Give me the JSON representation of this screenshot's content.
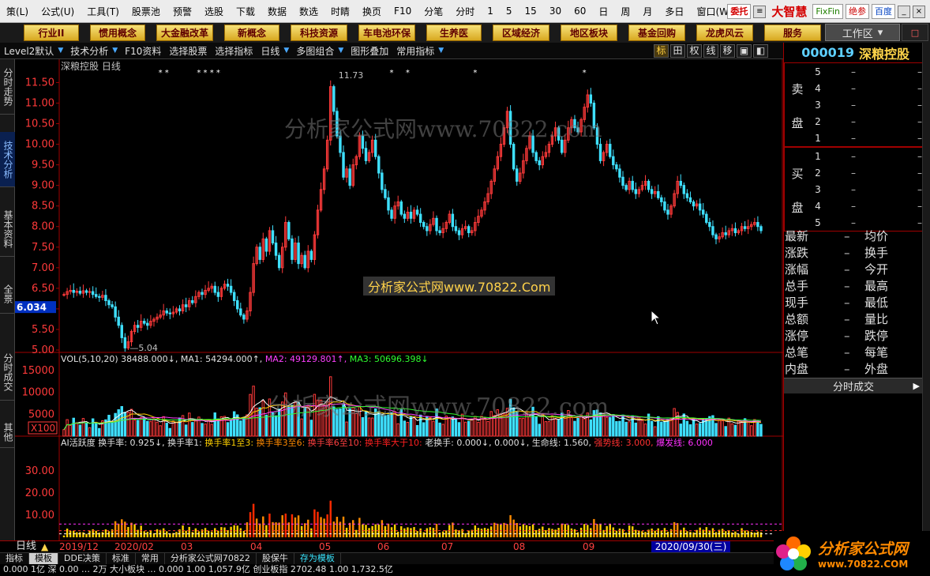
{
  "menu": [
    "策(L)",
    "公式(U)",
    "工具(T)",
    "股票池",
    "预警",
    "选股",
    "下载",
    "数据",
    "数选",
    "时睛",
    "换页",
    "F10",
    "分笔",
    "分时",
    "1",
    "5",
    "15",
    "30",
    "60",
    "日",
    "周",
    "月",
    "多日",
    "窗口(W)"
  ],
  "menu_right": {
    "entrust": "委托",
    "brand": "大智慧",
    "fixfin": "FixFin",
    "juecan": "绝参",
    "baidu": "百度",
    "win_min": "_",
    "win_close": "×"
  },
  "toolbar": [
    "行业II",
    "惯用概念",
    "大金融改革",
    "新概念",
    "科技资源",
    "车电池环保",
    "生养医",
    "区域经济",
    "地区板块",
    "基金回购",
    "龙虎风云",
    "服务"
  ],
  "workarea": {
    "label": "工作区",
    "arrow": "▾",
    "end_label": "□"
  },
  "subbar": [
    {
      "label": "Level2默认",
      "tri": true
    },
    {
      "label": "技术分析",
      "tri": true
    },
    {
      "label": "F10资料",
      "tri": false
    },
    {
      "label": "选择股票",
      "tri": false
    },
    {
      "label": "选择指标",
      "tri": false
    },
    {
      "label": "日线",
      "tri": true
    },
    {
      "label": "多图组合",
      "tri": true
    },
    {
      "label": "图形叠加",
      "tri": false
    },
    {
      "label": "常用指标",
      "tri": true
    }
  ],
  "right_icons": [
    "标",
    "田",
    "权",
    "线",
    "移",
    "▣",
    "◧"
  ],
  "left_tabs": [
    "分时走势",
    "技术分析",
    "基本资料",
    "全景",
    "分时成交",
    "其他"
  ],
  "stock": {
    "code": "000019",
    "name": "深粮控股",
    "period": "日线"
  },
  "chart_data": {
    "type": "candlestick",
    "title": "深粮控股 日线",
    "price_axis": {
      "ticks": [
        5.0,
        5.5,
        6.0,
        6.5,
        7.0,
        7.5,
        8.0,
        8.5,
        9.0,
        9.5,
        10.0,
        10.5,
        11.0,
        11.5
      ],
      "ylim": [
        5.0,
        11.7
      ],
      "current": 6.034
    },
    "annotations": {
      "low": "5.04",
      "high": "11.73"
    },
    "vol_axis": {
      "ticks": [
        5000,
        10000,
        15000
      ],
      "unit": "X100"
    },
    "vol_legend": {
      "name": "VOL(5,10,20)",
      "vol": "38488.000",
      "ma1": "MA1: 54294.000",
      "ma2": "MA2: 49129.801",
      "ma3": "MA3: 50696.398"
    },
    "ai_axis": {
      "ticks": [
        10.0,
        20.0,
        30.0
      ]
    },
    "ai_legend": {
      "name": "AI活跃度",
      "t1": "换手率: 0.925",
      "t2": "换手率1:",
      "t3": "换手率1至3:",
      "t4": "换手率3至6:",
      "t5": "换手率6至10:",
      "t6": "换手率大于10:",
      "t7": "老换手: 0.000",
      "t8": "0.000",
      "t9": "生命线: 1.560,",
      "t10": "强势线: 3.000,",
      "t11": "爆发线: 6.000"
    },
    "months": [
      "2019/12",
      "2020/02",
      "03",
      "04",
      "05",
      "06",
      "07",
      "08",
      "09"
    ],
    "date_label": "2020/09/30(三)",
    "series_close": [
      6.35,
      6.42,
      6.45,
      6.4,
      6.43,
      6.38,
      6.44,
      6.4,
      6.42,
      6.35,
      6.3,
      6.28,
      6.33,
      6.2,
      6.1,
      6.05,
      5.8,
      5.6,
      5.3,
      5.05,
      5.2,
      5.45,
      5.6,
      5.55,
      5.7,
      5.65,
      5.6,
      5.7,
      5.75,
      5.8,
      5.85,
      5.95,
      5.9,
      5.88,
      5.92,
      6.0,
      5.95,
      6.1,
      6.05,
      6.2,
      6.15,
      6.3,
      6.4,
      6.35,
      6.45,
      6.5,
      6.55,
      6.4,
      6.3,
      6.5,
      6.6,
      6.55,
      6.4,
      6.2,
      6.0,
      5.85,
      5.75,
      5.95,
      6.4,
      7.1,
      7.5,
      7.2,
      7.7,
      7.4,
      7.9,
      7.6,
      7.3,
      7.0,
      7.5,
      8.1,
      7.7,
      7.2,
      7.6,
      7.1,
      7.3,
      7.0,
      7.4,
      7.2,
      7.8,
      8.4,
      8.9,
      9.4,
      10.1,
      11.4,
      10.8,
      10.2,
      9.8,
      9.2,
      9.4,
      9.0,
      9.5,
      9.7,
      10.2,
      9.9,
      9.6,
      9.8,
      10.1,
      9.7,
      9.3,
      8.9,
      8.7,
      8.4,
      8.2,
      8.5,
      8.6,
      8.3,
      8.2,
      8.35,
      8.2,
      8.4,
      8.3,
      8.1,
      8.0,
      7.9,
      8.05,
      8.2,
      7.9,
      7.85,
      7.95,
      8.1,
      8.3,
      8.0,
      7.9,
      7.8,
      7.95,
      8.0,
      7.85,
      7.9,
      8.1,
      8.25,
      8.4,
      8.6,
      8.8,
      9.1,
      9.4,
      9.7,
      10.0,
      10.4,
      10.8,
      10.0,
      9.4,
      9.1,
      9.3,
      9.6,
      9.9,
      10.2,
      9.8,
      9.6,
      9.5,
      9.7,
      9.8,
      10.0,
      10.2,
      10.4,
      10.1,
      9.8,
      10.1,
      10.4,
      10.6,
      10.4,
      10.3,
      10.6,
      10.9,
      11.2,
      11.0,
      10.4,
      10.0,
      9.6,
      9.8,
      10.0,
      9.7,
      9.5,
      9.4,
      9.2,
      9.0,
      8.9,
      9.1,
      8.9,
      8.8,
      8.9,
      9.0,
      9.1,
      8.9,
      8.8,
      8.85,
      8.7,
      8.6,
      8.4,
      8.3,
      8.5,
      8.8,
      9.1,
      9.0,
      8.8,
      8.7,
      8.6,
      8.5,
      8.55,
      8.4,
      8.3,
      8.1,
      8.0,
      7.8,
      7.7,
      7.75,
      7.85,
      7.8,
      7.9,
      7.95,
      7.85,
      7.9,
      8.0,
      7.95,
      8.0,
      8.05,
      8.1,
      8.0,
      7.9
    ]
  },
  "quote": {
    "sell_label_1": "卖",
    "sell_label_2": "盘",
    "buy_label_1": "买",
    "buy_label_2": "盘",
    "sell": [
      {
        "n": "5",
        "p": "–",
        "v": "–"
      },
      {
        "n": "4",
        "p": "–",
        "v": "–"
      },
      {
        "n": "3",
        "p": "–",
        "v": "–"
      },
      {
        "n": "2",
        "p": "–",
        "v": "–"
      },
      {
        "n": "1",
        "p": "–",
        "v": "–"
      }
    ],
    "buy": [
      {
        "n": "1",
        "p": "–",
        "v": "–"
      },
      {
        "n": "2",
        "p": "–",
        "v": "–"
      },
      {
        "n": "3",
        "p": "–",
        "v": "–"
      },
      {
        "n": "4",
        "p": "–",
        "v": "–"
      },
      {
        "n": "5",
        "p": "–",
        "v": "–"
      }
    ],
    "stats": [
      [
        "最新",
        "–",
        "均价"
      ],
      [
        "涨跌",
        "–",
        "换手"
      ],
      [
        "涨幅",
        "–",
        "今开"
      ],
      [
        "总手",
        "–",
        "最高"
      ],
      [
        "现手",
        "–",
        "最低"
      ],
      [
        "总额",
        "–",
        "量比"
      ],
      [
        "涨停",
        "–",
        "跌停"
      ],
      [
        "总笔",
        "–",
        "每笔"
      ],
      [
        "内盘",
        "–",
        "外盘"
      ]
    ],
    "fenshi": "分时成交",
    "fenshi_arrow": "▶"
  },
  "bottom": {
    "period": "日线",
    "tri": "▲",
    "tabs": [
      "指标",
      "模板",
      "DDE决策",
      "标准",
      "常用",
      "分析家公式网70822",
      "股保牛",
      "存为模板"
    ],
    "ticker": "0.000  1亿 深  0.00  …  2万  大小板块  …  0.000  1.00  1,057.9亿  创业板指  2702.48  1.00  1,732.5亿"
  },
  "watermarks": {
    "w1": "分析家公式网www.70822.com",
    "w2": "分析家公式网www.70822.com",
    "banner": "分析家公式网www.70822.Com"
  },
  "logo": {
    "t1": "分析家公式网",
    "t2": "www.70822.COM"
  },
  "colors": {
    "up": "#ff3a3a",
    "down": "#3fe0ff",
    "accent": "#ffd54a",
    "frame": "#a00000"
  }
}
